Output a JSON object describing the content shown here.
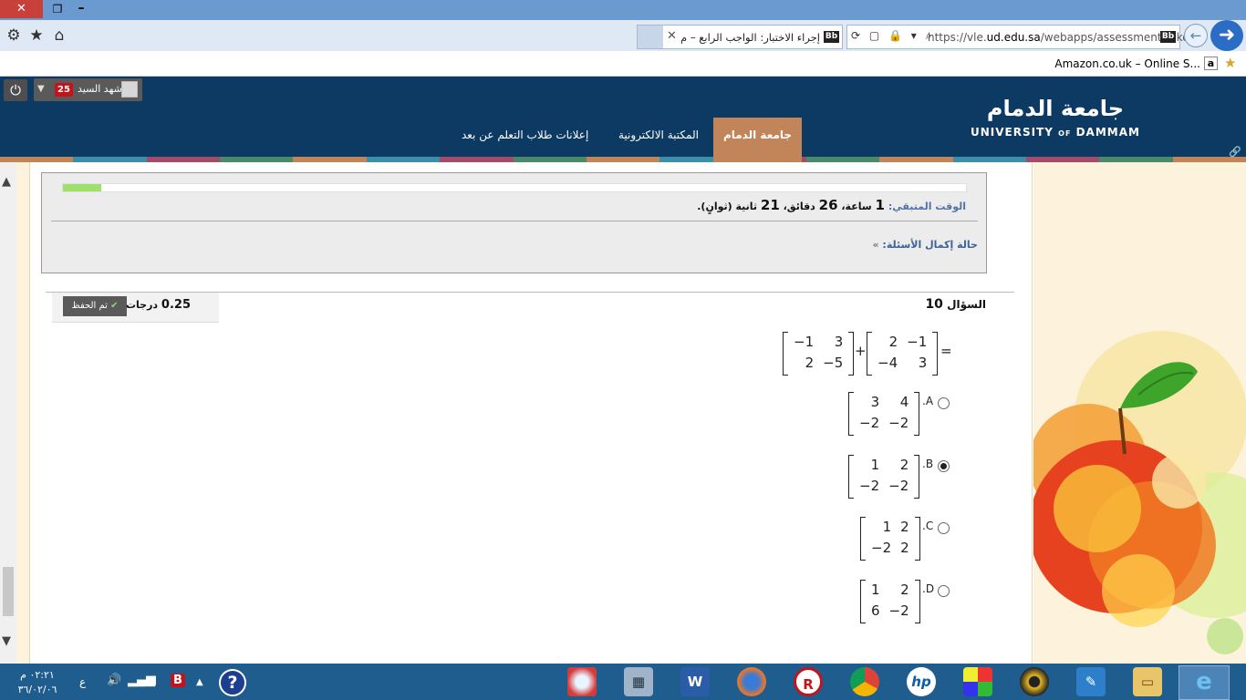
{
  "browser": {
    "tab_title": "إجراء الاختبار: الواجب الرابع – م...",
    "tab_badge": "Bb",
    "url_prefix": "https://vle.",
    "url_domain": "ud.edu.sa",
    "url_path": "/webapps/assessment/take",
    "address_badge": "Bb",
    "favorite_label": "Amazon.co.uk – Online S...",
    "favorite_icon_letter": "a"
  },
  "site": {
    "logo_arabic": "جامعة الدمام",
    "logo_english_1": "UNIVERSITY ",
    "logo_english_of": "OF",
    "logo_english_2": " DAMMAM",
    "user_name": "شهد السيد",
    "notification_count": "25",
    "nav_active": "جامعة الدمام",
    "nav_items": [
      "المكتبة الالكترونية",
      "إعلانات طلاب التعلم عن بعد"
    ],
    "stripe_colors": [
      "#c2855a",
      "#3c8fa8",
      "#a44a6b",
      "#4a8a6a",
      "#c2855a",
      "#3c8fa8",
      "#a44a6b",
      "#4a8a6a",
      "#c2855a",
      "#3c8fa8",
      "#a44a6b",
      "#4a8a6a",
      "#c2855a",
      "#3c8fa8",
      "#a44a6b",
      "#4a8a6a",
      "#c2855a"
    ]
  },
  "timer": {
    "label": "الوقت المتبقي:",
    "hours": "1",
    "hours_unit": "ساعة،",
    "minutes": "26",
    "minutes_unit": "دقائق،",
    "seconds": "21",
    "seconds_unit": "ثانية (ثوانٍ).",
    "progress_fraction": 0.042,
    "status_link": "حالة إكمال الأسئلة:"
  },
  "question": {
    "label": "السؤال",
    "number": "10",
    "points": "0.25",
    "points_unit": "درجات",
    "saved_label": "تم الحفظ",
    "operator_plus": "+",
    "operator_equals": "=",
    "matrix_a": [
      [
        "−1",
        "3"
      ],
      [
        "2",
        "−5"
      ]
    ],
    "matrix_b": [
      [
        "2",
        "−1"
      ],
      [
        "−4",
        "3"
      ]
    ],
    "options": [
      {
        "letter": ".A",
        "selected": false,
        "matrix": [
          [
            "3",
            "4"
          ],
          [
            "−2",
            "−2"
          ]
        ]
      },
      {
        "letter": ".B",
        "selected": true,
        "matrix": [
          [
            "1",
            "2"
          ],
          [
            "−2",
            "−2"
          ]
        ]
      },
      {
        "letter": ".C",
        "selected": false,
        "matrix": [
          [
            "1",
            "2"
          ],
          [
            "−2",
            "2"
          ]
        ]
      },
      {
        "letter": ".D",
        "selected": false,
        "matrix": [
          [
            "1",
            "2"
          ],
          [
            "6",
            "−2"
          ]
        ]
      }
    ]
  },
  "taskbar": {
    "time": "٠٢:٢١ م",
    "date": "٣٦/٠٢/٠٦",
    "language": "ع",
    "apps": [
      "sogou",
      "calculator",
      "word",
      "firefox",
      "r-app",
      "chrome",
      "hp",
      "photo-app",
      "media-player",
      "tool-app",
      "explorer",
      "internet-explorer"
    ]
  }
}
